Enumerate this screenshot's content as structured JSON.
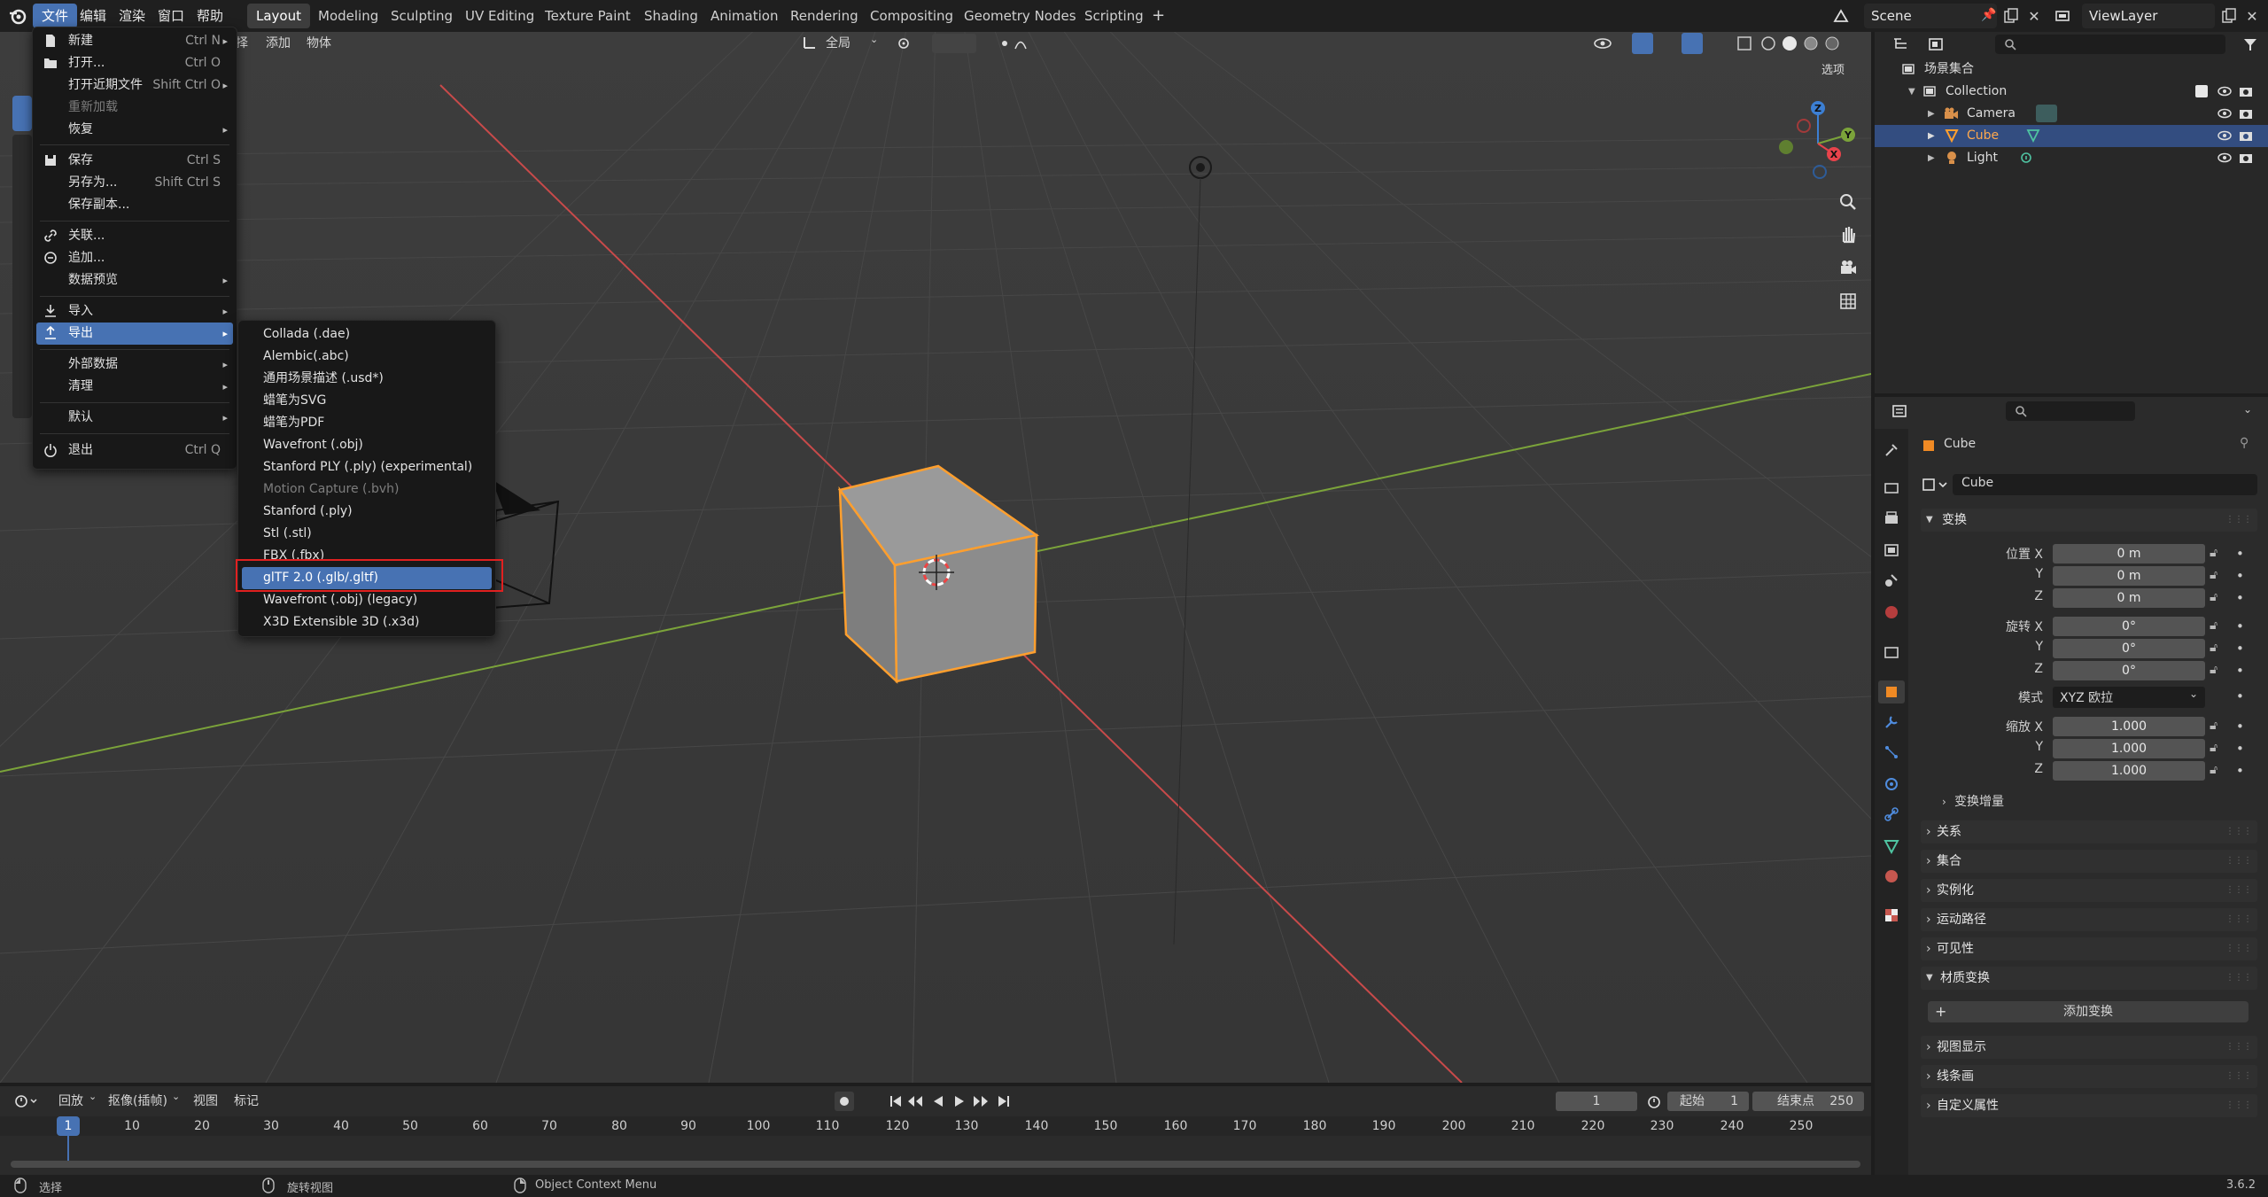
{
  "topbar": {
    "menus": [
      "文件",
      "编辑",
      "渲染",
      "窗口",
      "帮助"
    ],
    "workspaces": [
      "Layout",
      "Modeling",
      "Sculpting",
      "UV Editing",
      "Texture Paint",
      "Shading",
      "Animation",
      "Rendering",
      "Compositing",
      "Geometry Nodes",
      "Scripting"
    ],
    "add_tab": "+",
    "scene": "Scene",
    "view_layer": "ViewLayer"
  },
  "viewport_header": {
    "menus": [
      "择",
      "添加",
      "物体"
    ],
    "orientation": "全局",
    "options": "选项"
  },
  "file_menu": {
    "items": [
      {
        "label": "新建",
        "shortcut": "Ctrl N",
        "arrow": "▸",
        "icon": "new-file-icon"
      },
      {
        "label": "打开...",
        "shortcut": "Ctrl O",
        "icon": "folder-icon"
      },
      {
        "label": "打开近期文件",
        "shortcut": "Shift Ctrl O",
        "arrow": "▸"
      },
      {
        "label": "重新加载",
        "disabled": true
      },
      {
        "label": "恢复",
        "arrow": "▸"
      },
      {
        "label": "保存",
        "shortcut": "Ctrl S",
        "icon": "save-icon"
      },
      {
        "label": "另存为...",
        "shortcut": "Shift Ctrl S"
      },
      {
        "label": "保存副本..."
      },
      {
        "label": "关联...",
        "icon": "link-icon"
      },
      {
        "label": "追加...",
        "icon": "append-icon"
      },
      {
        "label": "数据预览",
        "arrow": "▸"
      },
      {
        "label": "导入",
        "arrow": "▸",
        "icon": "import-icon"
      },
      {
        "label": "导出",
        "arrow": "▸",
        "icon": "export-icon",
        "highlighted": true
      },
      {
        "label": "外部数据",
        "arrow": "▸"
      },
      {
        "label": "清理",
        "arrow": "▸"
      },
      {
        "label": "默认",
        "arrow": "▸"
      },
      {
        "label": "退出",
        "shortcut": "Ctrl Q",
        "icon": "power-icon"
      }
    ]
  },
  "export_menu": {
    "items": [
      {
        "label": "Collada (.dae)"
      },
      {
        "label": "Alembic(.abc)"
      },
      {
        "label": "通用场景描述 (.usd*)"
      },
      {
        "label": "蜡笔为SVG"
      },
      {
        "label": "蜡笔为PDF"
      },
      {
        "label": "Wavefront (.obj)"
      },
      {
        "label": "Stanford PLY (.ply) (experimental)"
      },
      {
        "label": "Motion Capture (.bvh)",
        "disabled": true
      },
      {
        "label": "Stanford (.ply)"
      },
      {
        "label": "Stl (.stl)"
      },
      {
        "label": "FBX (.fbx)"
      },
      {
        "label": "glTF 2.0 (.glb/.gltf)",
        "highlighted": true
      },
      {
        "label": "Wavefront (.obj) (legacy)"
      },
      {
        "label": "X3D Extensible 3D (.x3d)"
      }
    ]
  },
  "outliner": {
    "scene_collection": "场景集合",
    "collection": "Collection",
    "objects": [
      {
        "name": "Camera",
        "selected": false
      },
      {
        "name": "Cube",
        "selected": true
      },
      {
        "name": "Light",
        "selected": false
      }
    ]
  },
  "properties": {
    "object_name": "Cube",
    "data_name": "Cube",
    "transform_header": "变换",
    "location_label": "位置 X",
    "rotation_label": "旋转 X",
    "scale_label": "缩放 X",
    "y": "Y",
    "z": "Z",
    "location": [
      "0 m",
      "0 m",
      "0 m"
    ],
    "rotation": [
      "0°",
      "0°",
      "0°"
    ],
    "mode_label": "模式",
    "rotation_mode": "XYZ 欧拉",
    "scale": [
      "1.000",
      "1.000",
      "1.000"
    ],
    "delta_transform": "变换增量",
    "sections": [
      "关系",
      "集合",
      "实例化",
      "运动路径",
      "可见性"
    ],
    "material_header": "材质变换",
    "add_button": "添加变换",
    "sections2": [
      "视图显示",
      "线条画",
      "自定义属性"
    ]
  },
  "timeline": {
    "menus": [
      "回放",
      "抠像(插帧)",
      "视图",
      "标记"
    ],
    "current_frame": "1",
    "start_label": "起始",
    "start": "1",
    "end_label": "结束点",
    "end": "250",
    "ticks": [
      "1",
      "10",
      "20",
      "30",
      "40",
      "50",
      "60",
      "70",
      "80",
      "90",
      "100",
      "110",
      "120",
      "130",
      "140",
      "150",
      "160",
      "170",
      "180",
      "190",
      "200",
      "210",
      "220",
      "230",
      "240",
      "250"
    ]
  },
  "statusbar": {
    "select": "选择",
    "rotate_view": "旋转视图",
    "context_menu": "Object Context Menu",
    "version": "3.6.2"
  },
  "colors": {
    "accent": "#4772b3",
    "selection": "#ff9f2e",
    "x_axis": "#c84a4a",
    "y_axis": "#7ba33a",
    "annotation": "#e02020"
  }
}
